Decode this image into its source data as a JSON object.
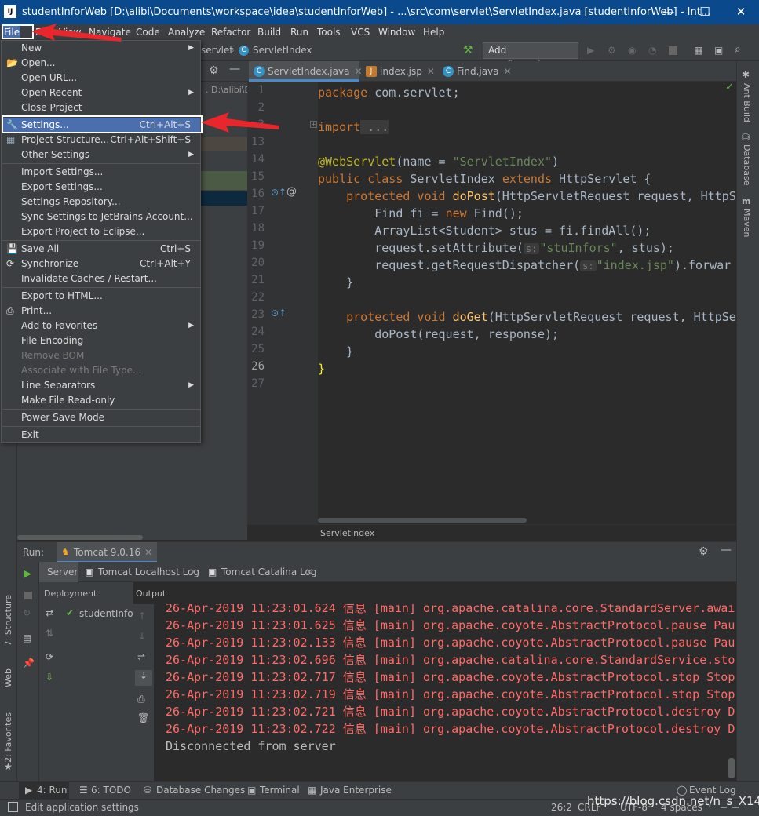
{
  "window": {
    "title": "studentInforWeb [D:\\alibi\\Documents\\workspace\\idea\\studentInforWeb] - ...\\src\\com\\servlet\\ServletIndex.java [studentInforWeb] - Int...",
    "logo": "IJ"
  },
  "menubar": [
    "File",
    "Edit",
    "View",
    "Navigate",
    "Code",
    "Analyze",
    "Refactor",
    "Build",
    "Run",
    "Tools",
    "VCS",
    "Window",
    "Help"
  ],
  "navbar": {
    "crumb1": "servlet",
    "crumb2": "ServletIndex",
    "config": "Add Configuration..."
  },
  "project_path": ". D:\\alibi\\D",
  "tabs": [
    {
      "label": "ServletIndex.java",
      "icon": "C"
    },
    {
      "label": "index.jsp",
      "icon": "J"
    },
    {
      "label": "Find.java",
      "icon": "C"
    }
  ],
  "code": {
    "line_numbers": [
      "1",
      "2",
      "3",
      "13",
      "14",
      "15",
      "16",
      "17",
      "18",
      "19",
      "20",
      "21",
      "22",
      "23",
      "24",
      "25",
      "26",
      "27"
    ],
    "l1a": "package",
    "l1b": " com.servlet;",
    "l3a": "import",
    "l3b": " ...",
    "l14a": "@WebServlet",
    "l14b": "(name = ",
    "l14c": "\"ServletIndex\"",
    "l14d": ")",
    "l15a": "public class",
    "l15b": " ServletIndex ",
    "l15c": "extends",
    "l15d": " HttpServlet {",
    "l16a": "    protected void ",
    "l16b": "doPost",
    "l16c": "(HttpServletRequest request, HttpSe",
    "l17a": "        Find fi = ",
    "l17b": "new",
    "l17c": " Find();",
    "l18": "        ArrayList<Student> stus = fi.findAll();",
    "l19a": "        request.setAttribute(",
    "l19h": "s:",
    "l19b": "\"stuInfors\"",
    "l19c": ", stus);",
    "l20a": "        request.getRequestDispatcher(",
    "l20h": "s:",
    "l20b": "\"index.jsp\"",
    "l20c": ").forwar",
    "l21": "    }",
    "l23a": "    protected void ",
    "l23b": "doGet",
    "l23c": "(HttpServletRequest request, HttpSe",
    "l24": "        doPost(request, response);",
    "l25": "    }",
    "l26": "}"
  },
  "breadcrumb_bottom": "ServletIndex",
  "run": {
    "label": "Run:",
    "config": "Tomcat 9.0.16",
    "subtabs": [
      "Server",
      "Tomcat Localhost Log",
      "Tomcat Catalina Log"
    ],
    "deployment": "Deployment",
    "output": "Output",
    "artifact": "studentInfor",
    "console": [
      "26-Apr-2019 11:23:01.624 信息 [main] org.apache.catalina.core.StandardServer.awai",
      "26-Apr-2019 11:23:01.625 信息 [main] org.apache.coyote.AbstractProtocol.pause Pau",
      "26-Apr-2019 11:23:02.133 信息 [main] org.apache.coyote.AbstractProtocol.pause Pau",
      "26-Apr-2019 11:23:02.696 信息 [main] org.apache.catalina.core.StandardService.sto",
      "26-Apr-2019 11:23:02.717 信息 [main] org.apache.coyote.AbstractProtocol.stop Stop",
      "26-Apr-2019 11:23:02.719 信息 [main] org.apache.coyote.AbstractProtocol.stop Stop",
      "26-Apr-2019 11:23:02.721 信息 [main] org.apache.coyote.AbstractProtocol.destroy D",
      "26-Apr-2019 11:23:02.722 信息 [main] org.apache.coyote.AbstractProtocol.destroy D"
    ],
    "disconnected": "Disconnected from server"
  },
  "left_tools": [
    "7: Structure",
    "Web",
    "2: Favorites"
  ],
  "right_tools": [
    "Ant Build",
    "Database",
    "Maven"
  ],
  "bottom_tabs": [
    "4: Run",
    "6: TODO",
    "Database Changes",
    "Terminal",
    "Java Enterprise",
    "Event Log"
  ],
  "status": {
    "left": "Edit application settings",
    "pos": "26:2",
    "crlf": "CRLF",
    "enc": "UTF-8",
    "indent": "4 spaces",
    "watermark": "https://blog.csdn.net/n_s_X14"
  },
  "file_menu": [
    {
      "label": "New",
      "arrow": true
    },
    {
      "label": "Open...",
      "icon": "folder"
    },
    {
      "label": "Open URL..."
    },
    {
      "label": "Open Recent",
      "arrow": true
    },
    {
      "label": "Close Project"
    },
    {
      "sep": true
    },
    {
      "label": "Settings...",
      "shortcut": "Ctrl+Alt+S",
      "icon": "wrench",
      "highlight": true
    },
    {
      "label": "Project Structure...",
      "shortcut": "Ctrl+Alt+Shift+S",
      "icon": "structure"
    },
    {
      "label": "Other Settings",
      "arrow": true
    },
    {
      "sep": true
    },
    {
      "label": "Import Settings..."
    },
    {
      "label": "Export Settings..."
    },
    {
      "label": "Settings Repository..."
    },
    {
      "label": "Sync Settings to JetBrains Account..."
    },
    {
      "label": "Export Project to Eclipse..."
    },
    {
      "sep": true
    },
    {
      "label": "Save All",
      "shortcut": "Ctrl+S",
      "icon": "save"
    },
    {
      "label": "Synchronize",
      "shortcut": "Ctrl+Alt+Y",
      "icon": "sync"
    },
    {
      "label": "Invalidate Caches / Restart..."
    },
    {
      "sep": true
    },
    {
      "label": "Export to HTML..."
    },
    {
      "label": "Print...",
      "icon": "print"
    },
    {
      "label": "Add to Favorites",
      "arrow": true
    },
    {
      "label": "File Encoding"
    },
    {
      "label": "Remove BOM",
      "disabled": true
    },
    {
      "label": "Associate with File Type...",
      "disabled": true
    },
    {
      "label": "Line Separators",
      "arrow": true
    },
    {
      "label": "Make File Read-only"
    },
    {
      "sep": true
    },
    {
      "label": "Power Save Mode"
    },
    {
      "sep": true
    },
    {
      "label": "Exit"
    }
  ],
  "colors": {
    "accent": "#4b6eaf",
    "arrow": "#e8262c",
    "titlebar": "#0a4a8c"
  }
}
